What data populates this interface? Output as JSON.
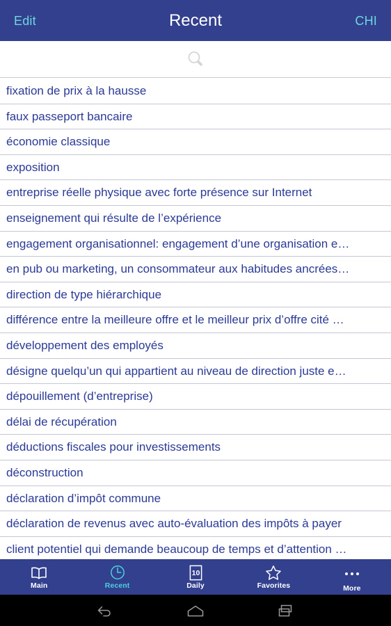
{
  "navbar": {
    "left_button": "Edit",
    "title": "Recent",
    "right_button": "CHI"
  },
  "search": {
    "icon": "search-icon",
    "placeholder": "",
    "value": ""
  },
  "list": {
    "items": [
      {
        "label": "fixation de prix à la hausse"
      },
      {
        "label": "faux passeport bancaire"
      },
      {
        "label": "économie classique"
      },
      {
        "label": "exposition"
      },
      {
        "label": "entreprise réelle physique avec forte présence sur Internet"
      },
      {
        "label": "enseignement qui résulte de l’expérience"
      },
      {
        "label": "engagement organisationnel: engagement d’une organisation e…"
      },
      {
        "label": "en pub ou marketing, un consommateur aux habitudes ancrées…"
      },
      {
        "label": "direction de type hiérarchique"
      },
      {
        "label": "différence entre la meilleure offre et le meilleur prix d’offre cité …"
      },
      {
        "label": "développement des employés"
      },
      {
        "label": "désigne quelqu’un qui appartient au niveau de direction juste e…"
      },
      {
        "label": "dépouillement (d’entreprise)"
      },
      {
        "label": "délai de récupération"
      },
      {
        "label": "déductions fiscales pour investissements"
      },
      {
        "label": "déconstruction"
      },
      {
        "label": "déclaration d’impôt commune"
      },
      {
        "label": "déclaration de revenus avec auto-évaluation des impôts à payer"
      },
      {
        "label": "client potentiel qui demande beaucoup de temps et d’attention …"
      }
    ]
  },
  "tabbar": {
    "tabs": [
      {
        "label": "Main",
        "icon": "book-icon",
        "active": false
      },
      {
        "label": "Recent",
        "icon": "clock-icon",
        "active": true
      },
      {
        "label": "Daily",
        "icon": "calendar-10-icon",
        "active": false
      },
      {
        "label": "Favorites",
        "icon": "star-icon",
        "active": false
      },
      {
        "label": "More",
        "icon": "ellipsis-icon",
        "active": false
      }
    ]
  },
  "sysnav": {
    "back": "back-icon",
    "home": "home-icon",
    "recents": "recents-icon"
  },
  "colors": {
    "brand_blue": "#32408e",
    "accent_cyan": "#4ad2dc",
    "list_text": "#2b3a96",
    "separator": "#c6c7d6",
    "background": "#ffffff"
  }
}
